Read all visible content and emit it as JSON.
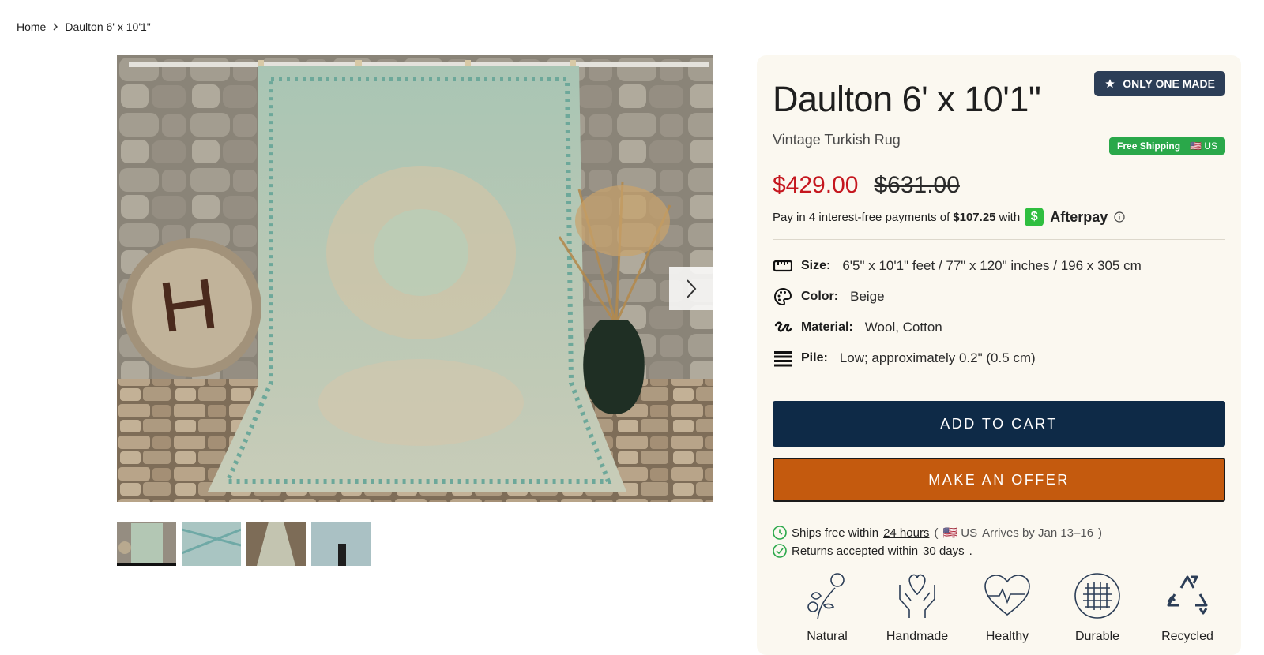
{
  "breadcrumb": {
    "home": "Home",
    "current": "Daulton 6' x 10'1\""
  },
  "gallery": {
    "next_icon": "chevron-right-icon",
    "thumb_count": 4
  },
  "product": {
    "title": "Daulton 6' x 10'1\"",
    "badge": "ONLY ONE MADE",
    "subtitle": "Vintage Turkish Rug",
    "shipping_badge": "Free Shipping",
    "shipping_region": "🇺🇸 US",
    "price": "$429.00",
    "compare_price": "$631.00",
    "afterpay": {
      "prefix": "Pay in 4 interest-free payments of",
      "amount": "$107.25",
      "with": "with",
      "brand": "Afterpay",
      "logo_char": "$"
    },
    "specs": [
      {
        "label": "Size:",
        "value": "6'5\" x 10'1\" feet / 77\" x 120\" inches / 196 x 305 cm",
        "icon": "ruler-icon"
      },
      {
        "label": "Color:",
        "value": "Beige",
        "icon": "palette-icon"
      },
      {
        "label": "Material:",
        "value": "Wool, Cotton",
        "icon": "yarn-icon"
      },
      {
        "label": "Pile:",
        "value": "Low; approximately 0.2\" (0.5 cm)",
        "icon": "layers-icon"
      }
    ],
    "add_to_cart": "ADD TO CART",
    "make_offer": "MAKE AN OFFER",
    "ships": {
      "prefix": "Ships free within",
      "link": "24 hours",
      "open": "(",
      "region": "🇺🇸 US",
      "arrives": "Arrives by Jan 13–16",
      "close": ")"
    },
    "returns": {
      "prefix": "Returns accepted within",
      "link": "30 days",
      "suffix": "."
    },
    "features": [
      "Natural",
      "Handmade",
      "Healthy",
      "Durable",
      "Recycled"
    ]
  },
  "colors": {
    "price_red": "#c5171f",
    "navy": "#0e2a47",
    "offer_orange": "#c45a0e",
    "success_green": "#2aa84a"
  }
}
